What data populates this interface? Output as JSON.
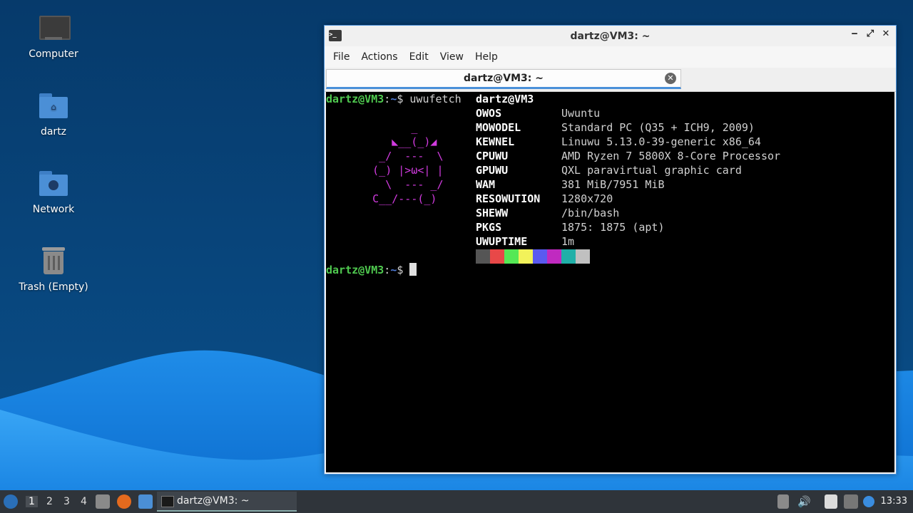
{
  "desktop": {
    "icons": [
      {
        "label": "Computer",
        "icon": "computer-icon"
      },
      {
        "label": "dartz",
        "icon": "home-folder-icon"
      },
      {
        "label": "Network",
        "icon": "network-folder-icon"
      },
      {
        "label": "Trash (Empty)",
        "icon": "trash-icon"
      }
    ]
  },
  "window": {
    "title": "dartz@VM3: ~",
    "controls": {
      "minimize": "‒",
      "maximize": "⤢",
      "close": "✕"
    },
    "menu": [
      "File",
      "Actions",
      "Edit",
      "View",
      "Help"
    ],
    "tab": {
      "label": "dartz@VM3: ~",
      "close": "✕"
    }
  },
  "terminal": {
    "prompt_user": "dartz@VM3",
    "prompt_sep": ":",
    "prompt_path": "~",
    "prompt_sym": "$",
    "command": " uwufetch",
    "header": "dartz@VM3",
    "art": "           _\n        ◣__(_)◢\n      _/  ---  \\\n     (_) |>ω<| |\n       \\  --- _/\n     C__/---(_)",
    "info": [
      {
        "key": "OWOS",
        "value": "Uwuntu"
      },
      {
        "key": "MOWODEL",
        "value": "Standard PC (Q35 + ICH9, 2009)"
      },
      {
        "key": "KEWNEL",
        "value": "Linuwu 5.13.0-39-generic x86_64"
      },
      {
        "key": "CPUWU",
        "value": "AMD Ryzen 7 5800X 8-Core Processor"
      },
      {
        "key": "GPUWU",
        "value": "QXL paravirtual graphic card"
      },
      {
        "key": "WAM",
        "value": "381 MiB/7951 MiB"
      },
      {
        "key": "RESOWUTION",
        "value": "1280x720"
      },
      {
        "key": "SHEWW",
        "value": "/bin/bash"
      },
      {
        "key": "PKGS",
        "value": "1875: 1875 (apt)"
      },
      {
        "key": "UWUPTIME",
        "value": "1m"
      }
    ],
    "palette": [
      "#555555",
      "#e84848",
      "#55e855",
      "#f2f25a",
      "#5a5af0",
      "#c02ac0",
      "#20b0a8",
      "#c0c0c0"
    ]
  },
  "taskbar": {
    "workspaces": [
      "1",
      "2",
      "3",
      "4"
    ],
    "active_workspace": "1",
    "task_label": "dartz@VM3: ~",
    "clock": "13:33"
  }
}
